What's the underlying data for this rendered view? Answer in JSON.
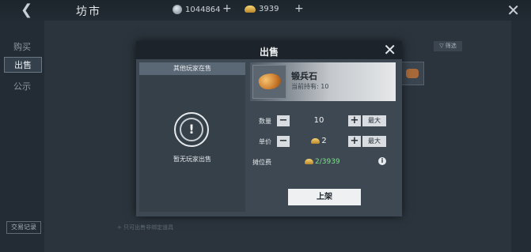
{
  "header": {
    "back_icon": "chevron-left-icon",
    "title": "坊市",
    "silver_amount": "1044864",
    "gold_amount": "3939",
    "plus_label": "+",
    "close_label": "✕"
  },
  "sidebar": {
    "items": [
      {
        "label": "购买",
        "active": false
      },
      {
        "label": "出售",
        "active": true
      },
      {
        "label": "公示",
        "active": false
      }
    ],
    "history_label": "交易记录"
  },
  "background": {
    "filter_label": "▽ 筛选",
    "hint_text": "+ 只可出售非绑定道具"
  },
  "modal": {
    "title": "出售",
    "close_label": "✕",
    "others_header": "其他玩家在售",
    "empty_icon": "exclamation-icon",
    "empty_text": "暂无玩家出售",
    "item": {
      "name": "锻兵石",
      "holding_text": "当前持有: 10"
    },
    "quantity": {
      "label": "数量",
      "minus": "−",
      "value": "10",
      "plus": "+",
      "max": "最大"
    },
    "price": {
      "label": "单价",
      "minus": "−",
      "value": "2",
      "plus": "+",
      "max": "最大"
    },
    "fee": {
      "label": "摊位费",
      "value": "2/3939"
    },
    "info_label": "i",
    "submit_label": "上架"
  },
  "colors": {
    "fee_green": "#7fe08a",
    "modal_bg": "#3d4853",
    "header_bg": "#1c232a"
  }
}
